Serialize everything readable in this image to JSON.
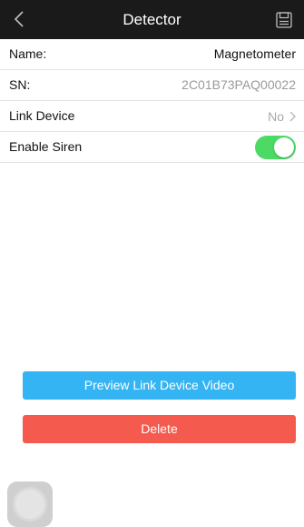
{
  "nav": {
    "title": "Detector",
    "back_icon": "chevron-left-icon",
    "save_icon": "save-disk-icon"
  },
  "fields": {
    "name_label": "Name:",
    "name_value": "Magnetometer",
    "sn_label": "SN:",
    "sn_value": "2C01B73PAQ00022",
    "link_label": "Link Device",
    "link_value": "No",
    "siren_label": "Enable Siren",
    "siren_on": true
  },
  "buttons": {
    "preview_label": "Preview Link Device Video",
    "delete_label": "Delete"
  },
  "colors": {
    "nav_bg": "#1a1a1a",
    "toggle_on": "#4cd964",
    "preview_button": "#34b4f2",
    "delete_button": "#f55a4e"
  }
}
